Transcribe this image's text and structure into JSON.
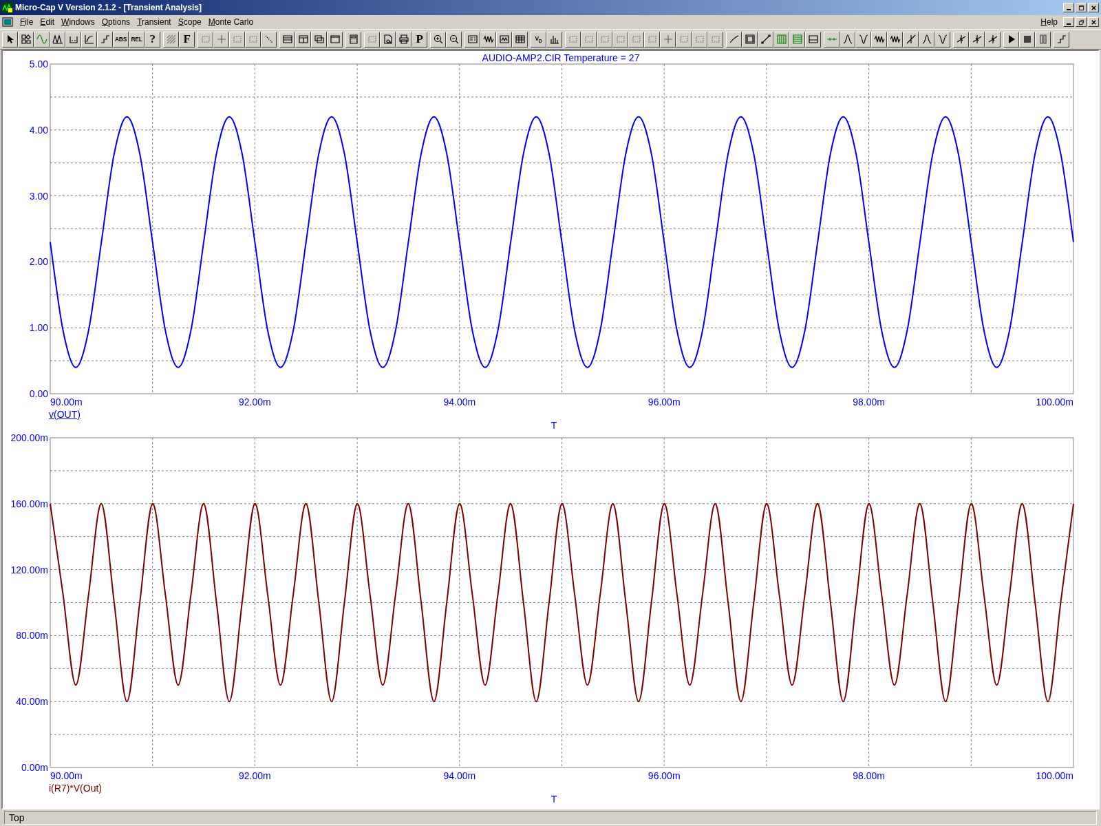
{
  "window": {
    "title": "Micro-Cap V Version 2.1.2 - [Transient Analysis]"
  },
  "menu": {
    "items": [
      "File",
      "Edit",
      "Windows",
      "Options",
      "Transient",
      "Scope",
      "Monte Carlo"
    ],
    "help": "Help"
  },
  "toolbar": [
    [
      {
        "kind": "icon"
      },
      {
        "kind": "icon"
      },
      {
        "kind": "icon"
      },
      {
        "kind": "icon"
      },
      {
        "kind": "icon"
      },
      {
        "kind": "icon"
      },
      {
        "kind": "icon"
      },
      {
        "kind": "text",
        "label": "ABS"
      },
      {
        "kind": "text",
        "label": "REL"
      },
      {
        "kind": "text",
        "label": "?"
      }
    ],
    [
      {
        "kind": "icon"
      },
      {
        "kind": "text",
        "label": "F"
      }
    ],
    [
      {
        "kind": "icon"
      },
      {
        "kind": "icon"
      },
      {
        "kind": "icon"
      },
      {
        "kind": "icon"
      },
      {
        "kind": "icon"
      }
    ],
    [
      {
        "kind": "icon"
      },
      {
        "kind": "icon"
      },
      {
        "kind": "icon"
      },
      {
        "kind": "icon"
      }
    ],
    [
      {
        "kind": "icon"
      }
    ],
    [
      {
        "kind": "icon"
      },
      {
        "kind": "icon"
      },
      {
        "kind": "icon"
      },
      {
        "kind": "text",
        "label": "P"
      }
    ],
    [
      {
        "kind": "icon"
      },
      {
        "kind": "icon"
      }
    ],
    [
      {
        "kind": "icon"
      },
      {
        "kind": "icon"
      },
      {
        "kind": "icon"
      },
      {
        "kind": "icon"
      }
    ],
    [
      {
        "kind": "text",
        "label": "V$_{D}$"
      },
      {
        "kind": "icon"
      }
    ],
    [
      {
        "kind": "icon"
      },
      {
        "kind": "icon"
      },
      {
        "kind": "icon"
      },
      {
        "kind": "icon"
      },
      {
        "kind": "icon"
      },
      {
        "kind": "icon"
      },
      {
        "kind": "icon"
      },
      {
        "kind": "icon"
      },
      {
        "kind": "icon"
      },
      {
        "kind": "icon"
      }
    ],
    [
      {
        "kind": "icon"
      },
      {
        "kind": "icon"
      },
      {
        "kind": "icon"
      },
      {
        "kind": "icon"
      },
      {
        "kind": "icon"
      },
      {
        "kind": "icon"
      }
    ],
    [
      {
        "kind": "icon"
      },
      {
        "kind": "icon"
      },
      {
        "kind": "icon"
      },
      {
        "kind": "icon"
      },
      {
        "kind": "icon"
      },
      {
        "kind": "icon"
      },
      {
        "kind": "icon"
      },
      {
        "kind": "icon"
      }
    ],
    [
      {
        "kind": "icon"
      },
      {
        "kind": "icon"
      },
      {
        "kind": "icon"
      }
    ],
    [
      {
        "kind": "icon"
      },
      {
        "kind": "icon"
      },
      {
        "kind": "icon"
      }
    ],
    [
      {
        "kind": "icon"
      }
    ]
  ],
  "plots": [
    {
      "selected": true,
      "chart_data": {
        "type": "line",
        "grid": true,
        "title": "AUDIO-AMP2.CIR Temperature = 27",
        "xlabel": "T",
        "x": [
          90,
          90.125,
          90.25,
          90.375,
          90.5,
          90.625,
          90.75,
          90.875,
          91,
          91.125,
          91.25,
          91.375,
          91.5,
          91.625,
          91.75,
          91.875,
          92,
          92.125,
          92.25,
          92.375,
          92.5,
          92.625,
          92.75,
          92.875,
          93,
          93.125,
          93.25,
          93.375,
          93.5,
          93.625,
          93.75,
          93.875,
          94,
          94.125,
          94.25,
          94.375,
          94.5,
          94.625,
          94.75,
          94.875,
          95,
          95.125,
          95.25,
          95.375,
          95.5,
          95.625,
          95.75,
          95.875,
          96,
          96.125,
          96.25,
          96.375,
          96.5,
          96.625,
          96.75,
          96.875,
          97,
          97.125,
          97.25,
          97.375,
          97.5,
          97.625,
          97.75,
          97.875,
          98,
          98.125,
          98.25,
          98.375,
          98.5,
          98.625,
          98.75,
          98.875,
          99,
          99.125,
          99.25,
          99.375,
          99.5,
          99.625,
          99.75,
          99.875,
          100
        ],
        "series": [
          {
            "name": "v(OUT)",
            "color": "#0000ff",
            "values": [
              2.3,
              0.96,
              0.4,
              0.96,
              2.3,
              3.64,
              4.2,
              3.64,
              2.3,
              0.96,
              0.4,
              0.96,
              2.3,
              3.64,
              4.2,
              3.64,
              2.3,
              0.96,
              0.4,
              0.96,
              2.3,
              3.64,
              4.2,
              3.64,
              2.3,
              0.96,
              0.4,
              0.96,
              2.3,
              3.64,
              4.2,
              3.64,
              2.3,
              0.96,
              0.4,
              0.96,
              2.3,
              3.64,
              4.2,
              3.64,
              2.3,
              0.96,
              0.4,
              0.96,
              2.3,
              3.64,
              4.2,
              3.64,
              2.3,
              0.96,
              0.4,
              0.96,
              2.3,
              3.64,
              4.2,
              3.64,
              2.3,
              0.96,
              0.4,
              0.96,
              2.3,
              3.64,
              4.2,
              3.64,
              2.3,
              0.96,
              0.4,
              0.96,
              2.3,
              3.64,
              4.2,
              3.64,
              2.3,
              0.96,
              0.4,
              0.96,
              2.3,
              3.64,
              4.2,
              3.64,
              2.3
            ]
          }
        ],
        "xlim": [
          90,
          100
        ],
        "ylim": [
          0,
          5
        ],
        "xticks": [
          {
            "value": 90,
            "label": "90.00m"
          },
          {
            "value": 92,
            "label": "92.00m"
          },
          {
            "value": 94,
            "label": "94.00m"
          },
          {
            "value": 96,
            "label": "96.00m"
          },
          {
            "value": 98,
            "label": "98.00m"
          },
          {
            "value": 100,
            "label": "100.00m"
          }
        ],
        "yticks": [
          {
            "value": 0,
            "label": "0.00"
          },
          {
            "value": 1,
            "label": "1.00"
          },
          {
            "value": 2,
            "label": "2.00"
          },
          {
            "value": 3,
            "label": "3.00"
          },
          {
            "value": 4,
            "label": "4.00"
          },
          {
            "value": 5,
            "label": "5.00"
          }
        ]
      }
    },
    {
      "selected": false,
      "chart_data": {
        "type": "line",
        "grid": true,
        "xlabel": "T",
        "x": [
          90,
          90.125,
          90.25,
          90.375,
          90.5,
          90.625,
          90.75,
          90.875,
          91,
          91.125,
          91.25,
          91.375,
          91.5,
          91.625,
          91.75,
          91.875,
          92,
          92.125,
          92.25,
          92.375,
          92.5,
          92.625,
          92.75,
          92.875,
          93,
          93.125,
          93.25,
          93.375,
          93.5,
          93.625,
          93.75,
          93.875,
          94,
          94.125,
          94.25,
          94.375,
          94.5,
          94.625,
          94.75,
          94.875,
          95,
          95.125,
          95.25,
          95.375,
          95.5,
          95.625,
          95.75,
          95.875,
          96,
          96.125,
          96.25,
          96.375,
          96.5,
          96.625,
          96.75,
          96.875,
          97,
          97.125,
          97.25,
          97.375,
          97.5,
          97.625,
          97.75,
          97.875,
          98,
          98.125,
          98.25,
          98.375,
          98.5,
          98.625,
          98.75,
          98.875,
          99,
          99.125,
          99.25,
          99.375,
          99.5,
          99.625,
          99.75,
          99.875,
          100
        ],
        "series": [
          {
            "name": "i(R7)*V(Out)",
            "color": "#800000",
            "values": [
              160,
              105,
              50,
              105,
              160,
              100,
              40,
              100,
              160,
              105,
              50,
              105,
              160,
              100,
              40,
              100,
              160,
              105,
              50,
              105,
              160,
              100,
              40,
              100,
              160,
              105,
              50,
              105,
              160,
              100,
              40,
              100,
              160,
              105,
              50,
              105,
              160,
              100,
              40,
              100,
              160,
              105,
              50,
              105,
              160,
              100,
              40,
              100,
              160,
              105,
              50,
              105,
              160,
              100,
              40,
              100,
              160,
              105,
              50,
              105,
              160,
              100,
              40,
              100,
              160,
              105,
              50,
              105,
              160,
              100,
              40,
              100,
              160,
              105,
              50,
              105,
              160,
              100,
              40,
              100,
              160
            ]
          }
        ],
        "xlim": [
          90,
          100
        ],
        "ylim": [
          0,
          200
        ],
        "xticks": [
          {
            "value": 90,
            "label": "90.00m"
          },
          {
            "value": 92,
            "label": "92.00m"
          },
          {
            "value": 94,
            "label": "94.00m"
          },
          {
            "value": 96,
            "label": "96.00m"
          },
          {
            "value": 98,
            "label": "98.00m"
          },
          {
            "value": 100,
            "label": "100.00m"
          }
        ],
        "yticks": [
          {
            "value": 0,
            "label": "0.00m"
          },
          {
            "value": 40,
            "label": "40.00m"
          },
          {
            "value": 80,
            "label": "80.00m"
          },
          {
            "value": 120,
            "label": "120.00m"
          },
          {
            "value": 160,
            "label": "160.00m"
          },
          {
            "value": 200,
            "label": "200.00m"
          }
        ]
      }
    }
  ],
  "status_bar": {
    "text": "Top"
  }
}
